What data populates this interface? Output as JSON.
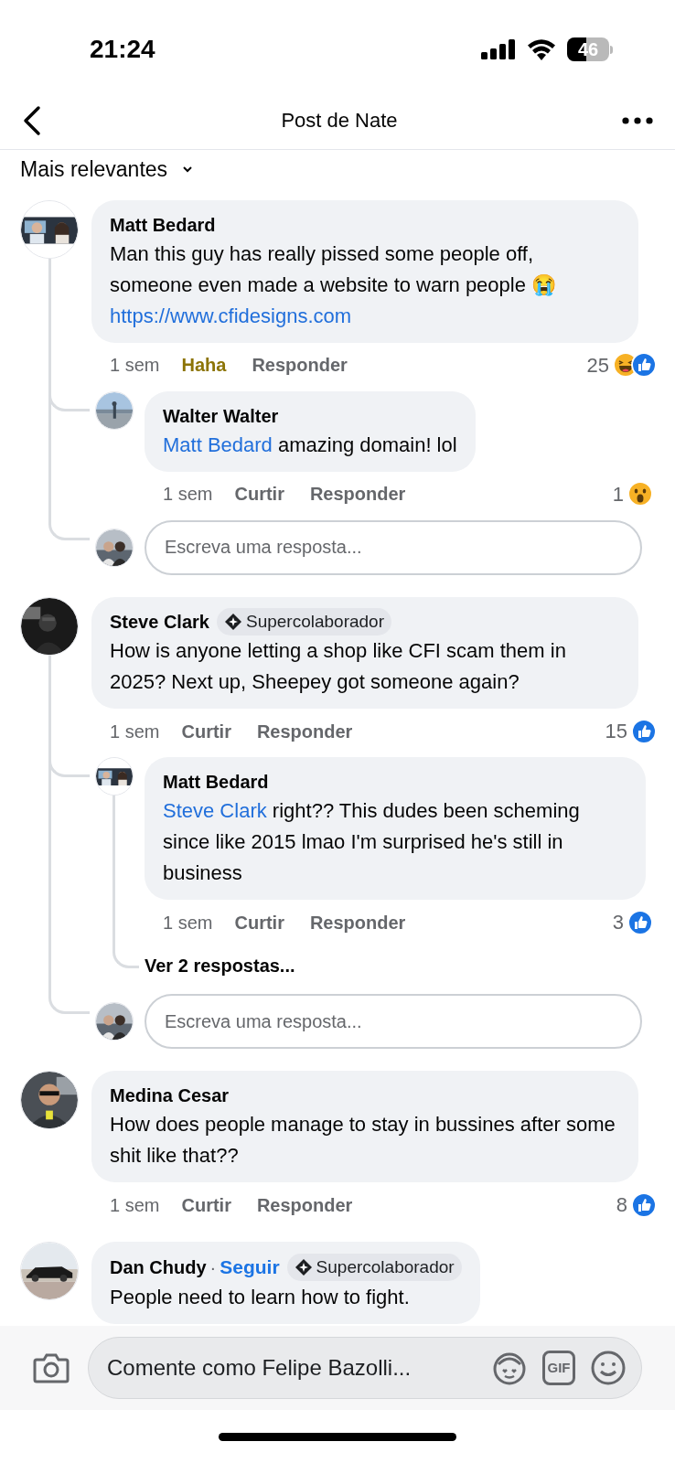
{
  "status_bar": {
    "time": "21:24",
    "battery": "46"
  },
  "header": {
    "title": "Post de Nate"
  },
  "sort": {
    "label": "Mais relevantes"
  },
  "comments": [
    {
      "author": "Matt Bedard",
      "text": "Man this guy has really pissed some people off, someone even made a website to warn people 😭",
      "link": "https://www.cfidesigns.com",
      "time": "1 sem",
      "like_label": "Haha",
      "reacted": true,
      "reply_label": "Responder",
      "count": "25",
      "reactions": [
        {
          "kind": "haha"
        },
        {
          "kind": "like"
        }
      ],
      "replies": [
        {
          "author": "Walter Walter",
          "mention": "Matt Bedard",
          "text": "amazing domain! lol",
          "time": "1 sem",
          "like_label": "Curtir",
          "reacted": false,
          "reply_label": "Responder",
          "count": "1",
          "reactions": [
            {
              "kind": "wow"
            }
          ]
        }
      ],
      "reply_box": {
        "placeholder": "Escreva uma resposta..."
      }
    },
    {
      "author": "Steve Clark",
      "badge": "Supercolaborador",
      "text": "How is anyone letting a shop like CFI scam them in 2025? Next up, Sheepey got someone again?",
      "time": "1 sem",
      "like_label": "Curtir",
      "reacted": false,
      "reply_label": "Responder",
      "count": "15",
      "reactions": [
        {
          "kind": "like"
        }
      ],
      "replies": [
        {
          "author": "Matt Bedard",
          "mention": "Steve Clark",
          "text": "right?? This dudes been scheming since like 2015 lmao I'm surprised he's still in business",
          "time": "1 sem",
          "like_label": "Curtir",
          "reacted": false,
          "reply_label": "Responder",
          "count": "3",
          "reactions": [
            {
              "kind": "like"
            }
          ],
          "more_replies": "Ver 2 respostas..."
        }
      ],
      "reply_box": {
        "placeholder": "Escreva uma resposta..."
      }
    },
    {
      "author": "Medina Cesar",
      "text": "How does people manage to stay in bussines after some shit like that??",
      "time": "1 sem",
      "like_label": "Curtir",
      "reacted": false,
      "reply_label": "Responder",
      "count": "8",
      "reactions": [
        {
          "kind": "like"
        }
      ]
    },
    {
      "author": "Dan Chudy",
      "follow": {
        "separator": "·",
        "label": "Seguir"
      },
      "badge": "Supercolaborador",
      "text": "People need to learn how to fight."
    }
  ],
  "composer": {
    "placeholder": "Comente como Felipe Bazolli...",
    "gif_label": "GIF"
  }
}
